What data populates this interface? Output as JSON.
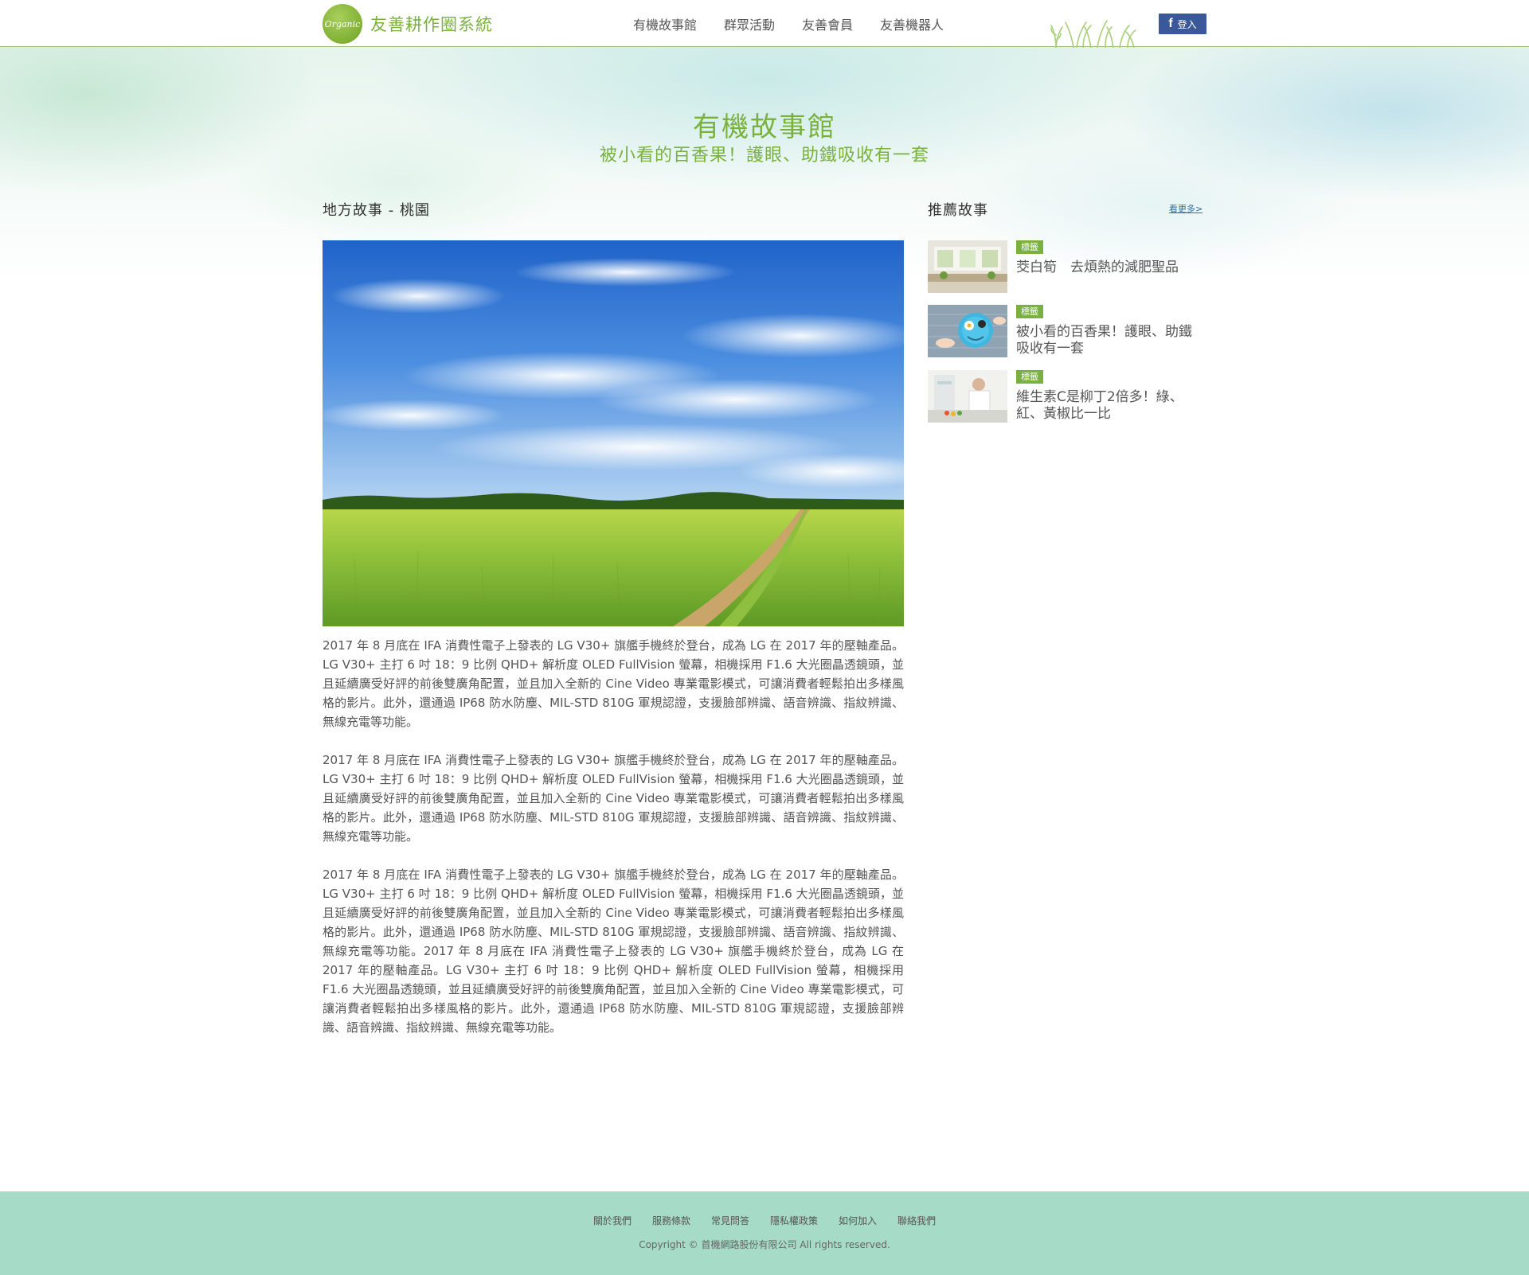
{
  "header": {
    "logo_badge": "Organic",
    "site_name": "友善耕作圈系統",
    "nav": [
      "有機故事館",
      "群眾活動",
      "友善會員",
      "友善機器人"
    ],
    "login_label": "登入",
    "login_icon": "facebook-icon"
  },
  "hero": {
    "title": "有機故事館",
    "subtitle": "被小看的百香果！護眼、助鐵吸收有一套"
  },
  "article": {
    "section_title": "地方故事 - 桃園",
    "paragraphs": [
      "2017 年 8 月底在 IFA 消費性電子上發表的 LG V30+ 旗艦手機終於登台，成為 LG 在 2017 年的壓軸產品。LG V30+ 主打 6 吋 18：9 比例 QHD+ 解析度 OLED FullVision 螢幕，相機採用 F1.6 大光圈晶透鏡頭，並且延續廣受好評的前後雙廣角配置，並且加入全新的 Cine Video 專業電影模式，可讓消費者輕鬆拍出多樣風格的影片。此外，還通過 IP68 防水防塵、MIL-STD 810G 軍規認證，支援臉部辨識、語音辨識、指紋辨識、無線充電等功能。",
      "2017 年 8 月底在 IFA 消費性電子上發表的 LG V30+ 旗艦手機終於登台，成為 LG 在 2017 年的壓軸產品。LG V30+ 主打 6 吋 18：9 比例 QHD+ 解析度 OLED FullVision 螢幕，相機採用 F1.6 大光圈晶透鏡頭，並且延續廣受好評的前後雙廣角配置，並且加入全新的 Cine Video 專業電影模式，可讓消費者輕鬆拍出多樣風格的影片。此外，還通過 IP68 防水防塵、MIL-STD 810G 軍規認證，支援臉部辨識、語音辨識、指紋辨識、無線充電等功能。",
      "2017 年 8 月底在 IFA 消費性電子上發表的 LG V30+ 旗艦手機終於登台，成為 LG 在 2017 年的壓軸產品。LG V30+ 主打 6 吋 18：9 比例 QHD+ 解析度 OLED FullVision 螢幕，相機採用 F1.6 大光圈晶透鏡頭，並且延續廣受好評的前後雙廣角配置，並且加入全新的 Cine Video 專業電影模式，可讓消費者輕鬆拍出多樣風格的影片。此外，還通過 IP68 防水防塵、MIL-STD 810G 軍規認證，支援臉部辨識、語音辨識、指紋辨識、無線充電等功能。2017 年 8 月底在 IFA 消費性電子上發表的 LG V30+ 旗艦手機終於登台，成為 LG 在 2017 年的壓軸產品。LG V30+ 主打 6 吋 18：9 比例 QHD+ 解析度 OLED FullVision 螢幕，相機採用 F1.6 大光圈晶透鏡頭，並且延續廣受好評的前後雙廣角配置，並且加入全新的 Cine Video 專業電影模式，可讓消費者輕鬆拍出多樣風格的影片。此外，還通過 IP68 防水防塵、MIL-STD 810G 軍規認證，支援臉部辨識、語音辨識、指紋辨識、無線充電等功能。"
    ]
  },
  "sidebar": {
    "title": "推薦故事",
    "more_label": "看更多>",
    "stories": [
      {
        "tag": "標籤",
        "title": "茭白筍　去煩熱的減肥聖品"
      },
      {
        "tag": "標籤",
        "title": "被小看的百香果！護眼、助鐵吸收有一套"
      },
      {
        "tag": "標籤",
        "title": "維生素C是柳丁2倍多！綠、紅、黃椒比一比"
      }
    ]
  },
  "footer": {
    "links": [
      "關於我們",
      "服務條款",
      "常見問答",
      "隱私權政策",
      "如何加入",
      "聯絡我們"
    ],
    "copyright": "Copyright © 首機網路股份有限公司 All rights reserved."
  },
  "colors": {
    "brand_green": "#7ab13c",
    "facebook_blue": "#3b5998",
    "footer_bg": "#a6dbc8",
    "link_blue": "#2f6e9e"
  }
}
